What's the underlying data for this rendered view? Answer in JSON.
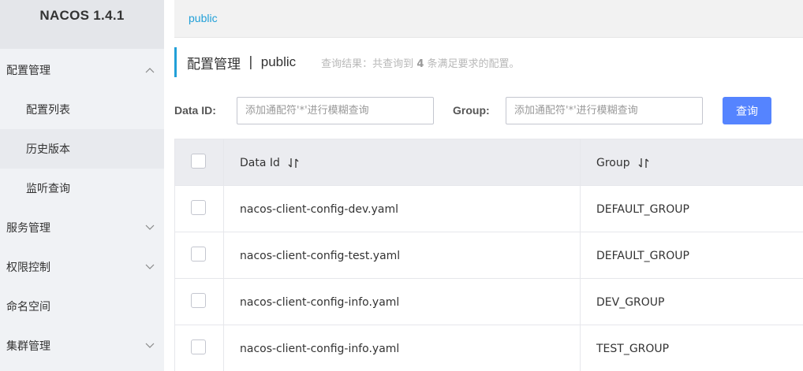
{
  "sidebar": {
    "brand": "NACOS 1.4.1",
    "items": [
      {
        "label": "配置管理",
        "expanded": true
      },
      {
        "label": "配置列表"
      },
      {
        "label": "历史版本"
      },
      {
        "label": "监听查询"
      },
      {
        "label": "服务管理",
        "expanded": false
      },
      {
        "label": "权限控制",
        "expanded": false
      },
      {
        "label": "命名空间"
      },
      {
        "label": "集群管理",
        "expanded": false
      }
    ]
  },
  "topbar": {
    "namespace": "public"
  },
  "page": {
    "title": "配置管理",
    "separator": "|",
    "namespace": "public",
    "result_prefix": "查询结果：共查询到",
    "result_count": "4",
    "result_suffix": "条满足要求的配置。"
  },
  "filter": {
    "data_id_label": "Data ID:",
    "data_id_placeholder": "添加通配符'*'进行模糊查询",
    "group_label": "Group:",
    "group_placeholder": "添加通配符'*'进行模糊查询",
    "query_button": "查询"
  },
  "table": {
    "columns": [
      "Data Id",
      "Group"
    ],
    "rows": [
      {
        "data_id": "nacos-client-config-dev.yaml",
        "group": "DEFAULT_GROUP"
      },
      {
        "data_id": "nacos-client-config-test.yaml",
        "group": "DEFAULT_GROUP"
      },
      {
        "data_id": "nacos-client-config-info.yaml",
        "group": "DEV_GROUP"
      },
      {
        "data_id": "nacos-client-config-info.yaml",
        "group": "TEST_GROUP"
      }
    ]
  },
  "colors": {
    "accent": "#22a0d8",
    "button": "#5584ff",
    "sidebar_bg": "#f0f2f5",
    "table_header_bg": "#ebecf0"
  }
}
